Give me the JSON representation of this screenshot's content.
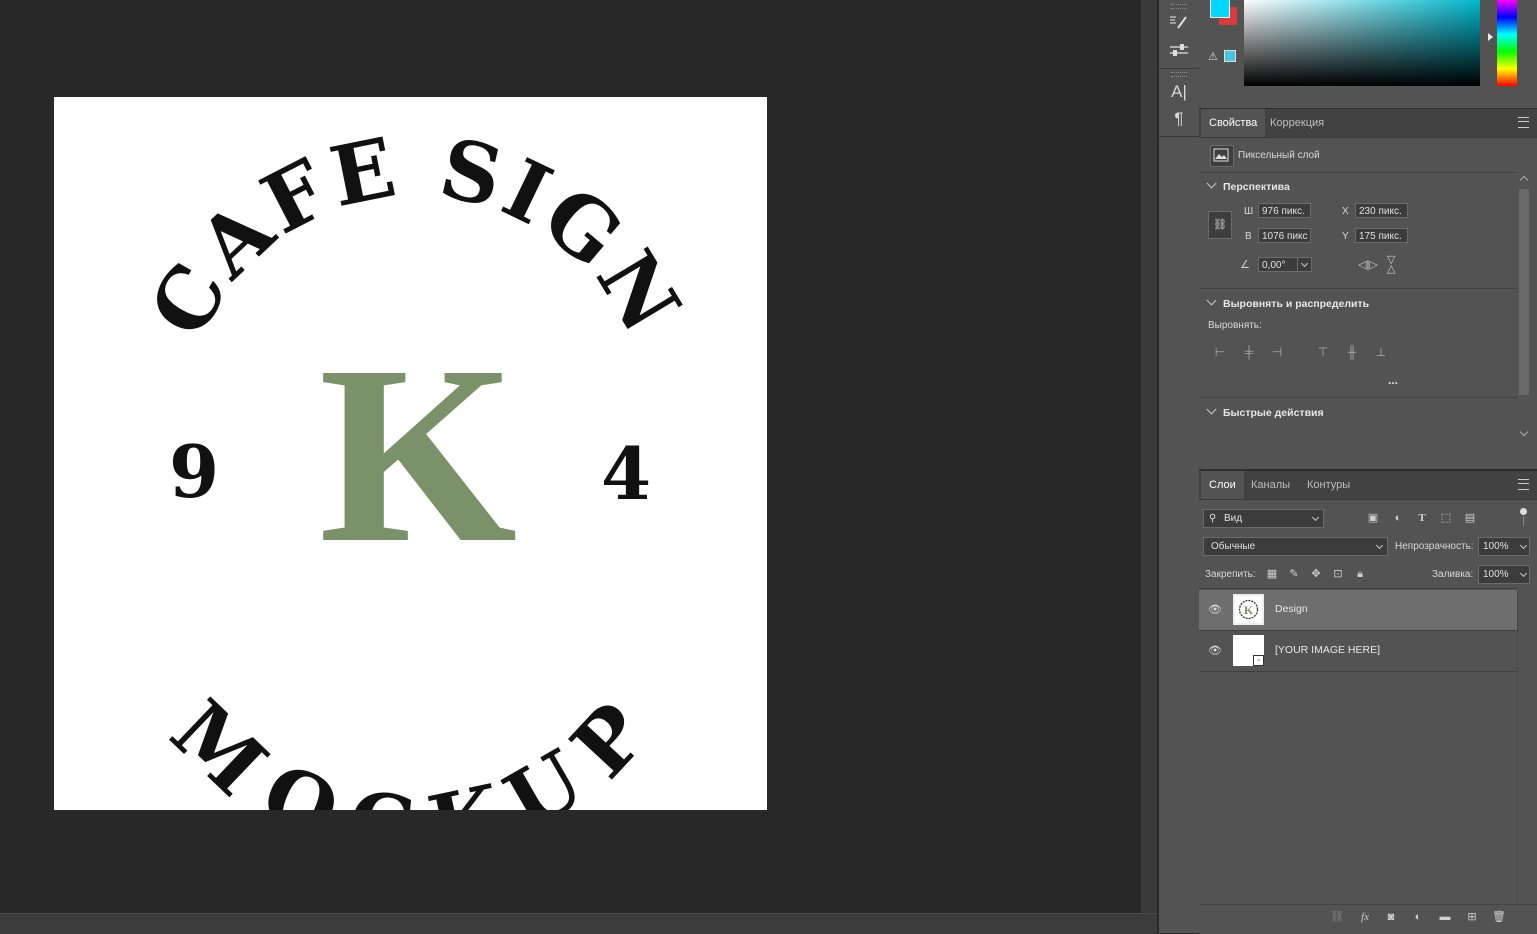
{
  "canvas": {
    "design": {
      "arc_top": "CAFE SIGN",
      "arc_bottom": "MOCKUP",
      "left_digit": "9",
      "right_digit": "4",
      "monogram": "K",
      "monogram_color": "#7a9169",
      "text_color": "#111111"
    }
  },
  "colors": {
    "foreground": "#00d8ff",
    "background": "#d93a3a"
  },
  "properties": {
    "tabs": [
      "Свойства",
      "Коррекция"
    ],
    "layer_type": "Пиксельный слой",
    "perspective_title": "Перспектива",
    "w_label": "Ш",
    "w_value": "976 пикс.",
    "h_label": "В",
    "h_value": "1076 пикс",
    "x_label": "X",
    "x_value": "230 пикс.",
    "y_label": "Y",
    "y_value": "175 пикс.",
    "angle_value": "0,00°",
    "align_title": "Выровнять и распределить",
    "align_label": "Выровнять:",
    "more": "...",
    "quick_actions_title": "Быстрые действия"
  },
  "layers_panel": {
    "tabs": [
      "Слои",
      "Каналы",
      "Контуры"
    ],
    "filter_value": "Вид",
    "blend_mode": "Обычные",
    "opacity_label": "Непрозрачность:",
    "opacity_value": "100%",
    "lock_label": "Закрепить:",
    "fill_label": "Заливка:",
    "fill_value": "100%",
    "layers": [
      {
        "name": "Design",
        "selected": true,
        "visible": true
      },
      {
        "name": "[YOUR IMAGE HERE]",
        "selected": false,
        "visible": true
      }
    ]
  },
  "icons": {
    "tools": [
      "brush-settings-icon",
      "adjust-sliders-icon",
      "character-icon",
      "paragraph-icon"
    ],
    "layers_filter": [
      "image-filter-icon",
      "adjustment-filter-icon",
      "type-filter-icon",
      "shape-filter-icon",
      "smart-object-filter-icon"
    ],
    "locks": [
      "lock-transparent-icon",
      "lock-image-icon",
      "lock-position-icon",
      "lock-artboard-icon",
      "lock-all-icon"
    ],
    "bottom": [
      "link-layers-icon",
      "fx-icon",
      "add-mask-icon",
      "adjustment-layer-icon",
      "new-group-icon",
      "new-layer-icon",
      "delete-layer-icon"
    ]
  }
}
